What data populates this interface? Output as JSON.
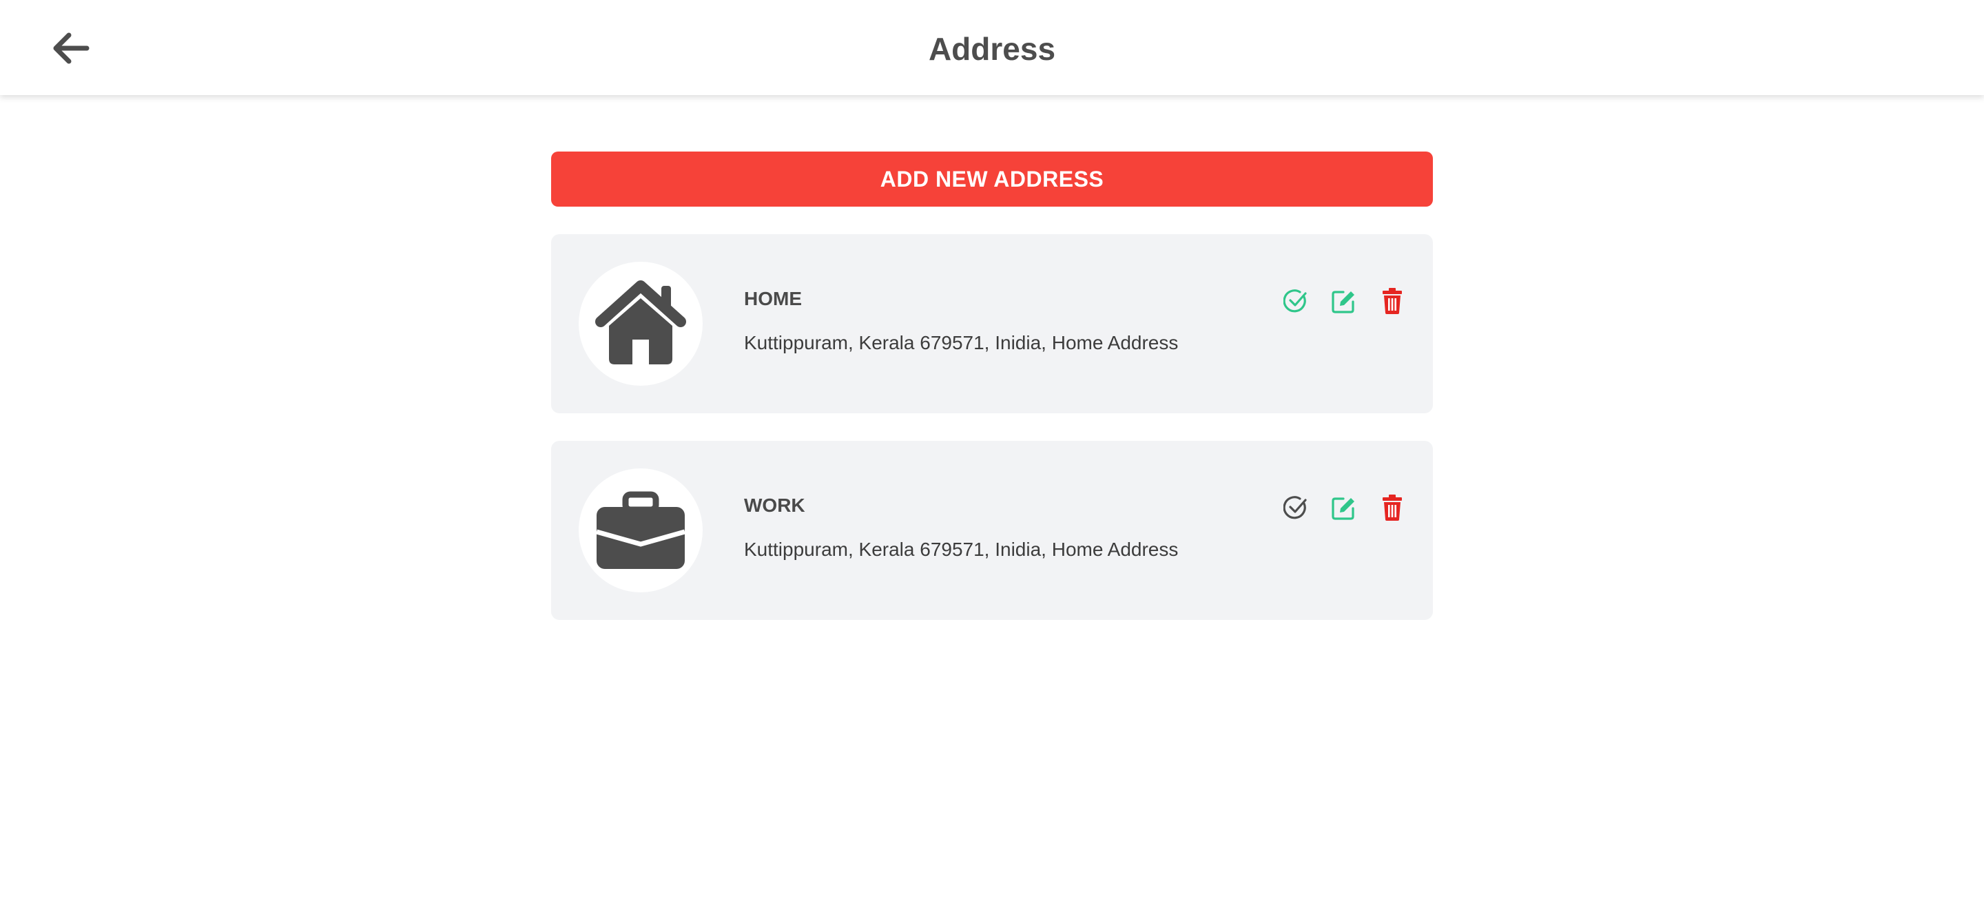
{
  "header": {
    "title": "Address",
    "back_icon": "arrow-left-icon"
  },
  "add_button": {
    "label": "ADD NEW ADDRESS",
    "color": "#f64239"
  },
  "addresses": [
    {
      "label": "HOME",
      "address": "Kuttippuram, Kerala 679571, Inidia, Home Address",
      "icon": "house-icon",
      "selected": true
    },
    {
      "label": "WORK",
      "address": "Kuttippuram, Kerala 679571, Inidia, Home Address",
      "icon": "briefcase-icon",
      "selected": false
    }
  ],
  "colors": {
    "accent_green": "#2fc68a",
    "delete_red": "#e52521",
    "icon_dark": "#4d4d4d",
    "card_bg": "#f2f3f5"
  }
}
